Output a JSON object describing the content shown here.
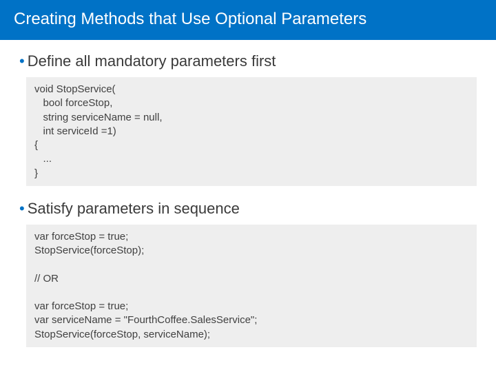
{
  "header": {
    "title": "Creating Methods that Use Optional Parameters"
  },
  "bullets": [
    {
      "text": "Define all mandatory parameters first"
    },
    {
      "text": "Satisfy parameters in sequence"
    }
  ],
  "code": {
    "block1": "void StopService(\n   bool forceStop,\n   string serviceName = null,\n   int serviceId =1)\n{\n   ...\n}",
    "block2": "var forceStop = true;\nStopService(forceStop);\n\n// OR\n\nvar forceStop = true;\nvar serviceName = \"FourthCoffee.SalesService\";\nStopService(forceStop, serviceName);"
  }
}
